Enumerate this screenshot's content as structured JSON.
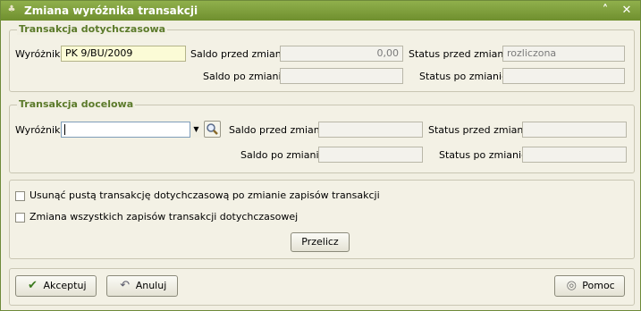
{
  "window": {
    "title": "Zmiana wyróżnika transakcji"
  },
  "source_group": {
    "legend": "Transakcja dotychczasowa",
    "id_label": "Wyróżnik:",
    "id_value": "PK 9/BU/2009",
    "balance_before_label": "Saldo przed zmianą:",
    "balance_before_value": "0,00",
    "status_before_label": "Status przed zmianą:",
    "status_before_value": "rozliczona",
    "balance_after_label": "Saldo po zmianie:",
    "balance_after_value": "",
    "status_after_label": "Status po zmianie:",
    "status_after_value": ""
  },
  "target_group": {
    "legend": "Transakcja docelowa",
    "id_label": "Wyróżnik:",
    "id_value": "",
    "balance_before_label": "Saldo przed zmianą:",
    "balance_before_value": "",
    "status_before_label": "Status przed zmianą:",
    "status_before_value": "",
    "balance_after_label": "Saldo po zmianie:",
    "balance_after_value": "",
    "status_after_label": "Status po zmianie:",
    "status_after_value": ""
  },
  "options": {
    "remove_empty_label": "Usunąć pustą transakcję dotychczasową po zmianie zapisów transakcji",
    "change_all_label": "Zmiana wszystkich zapisów transakcji dotychczasowej",
    "recalc_label": "Przelicz"
  },
  "footer": {
    "accept_label": "Akceptuj",
    "cancel_label": "Anuluj",
    "help_label": "Pomoc"
  },
  "icons": {
    "title": "tree-icon",
    "collapse": "chevron-up-icon",
    "close": "close-icon",
    "dropdown": "chevron-down-icon",
    "search": "magnifier-icon",
    "accept": "checkmark-icon",
    "cancel": "undo-icon",
    "help": "help-icon"
  }
}
